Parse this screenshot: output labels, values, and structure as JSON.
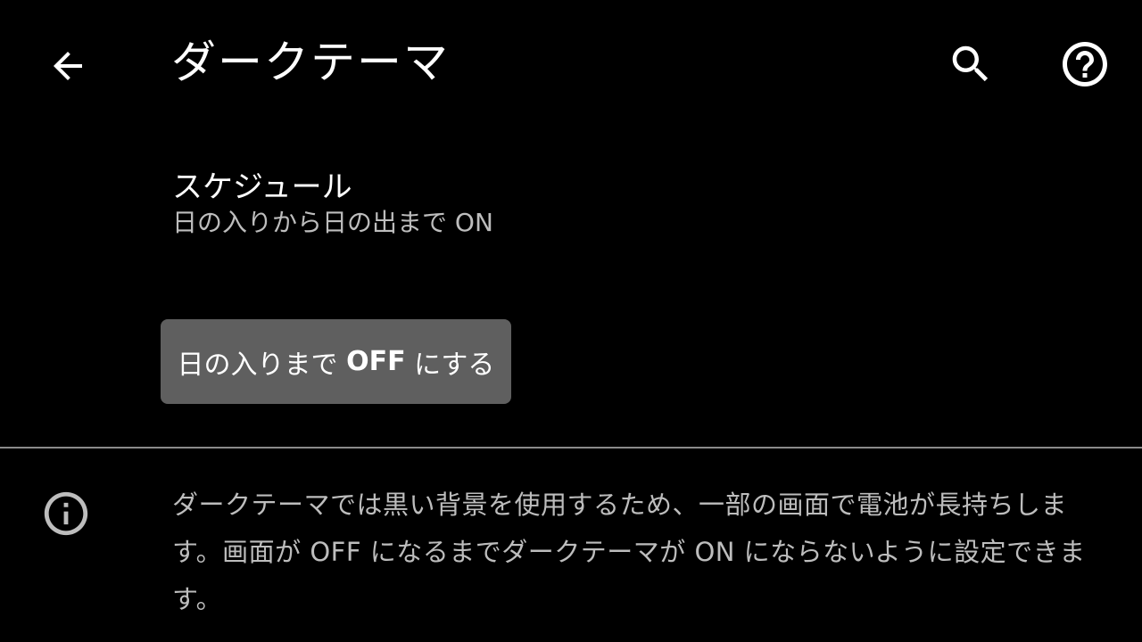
{
  "app_bar": {
    "title": "ダークテーマ",
    "back_icon": "arrow-back-icon",
    "search_icon": "search-icon",
    "help_icon": "help-icon"
  },
  "schedule": {
    "title": "スケジュール",
    "summary": "日の入りから日の出まで ON"
  },
  "action_button": {
    "prefix": "日の入りまで ",
    "bold": "OFF",
    "suffix": " にする"
  },
  "footer": {
    "info_icon": "info-icon",
    "text": "ダークテーマでは黒い背景を使用するため、一部の画面で電池が長持ちします。画面が OFF になるまでダークテーマが ON にならないように設定できます。"
  },
  "colors": {
    "background": "#000000",
    "primary_text": "#ffffff",
    "secondary_text": "#bdbdbd",
    "button_bg": "#5f5f5f",
    "divider": "#8a8a8a"
  }
}
